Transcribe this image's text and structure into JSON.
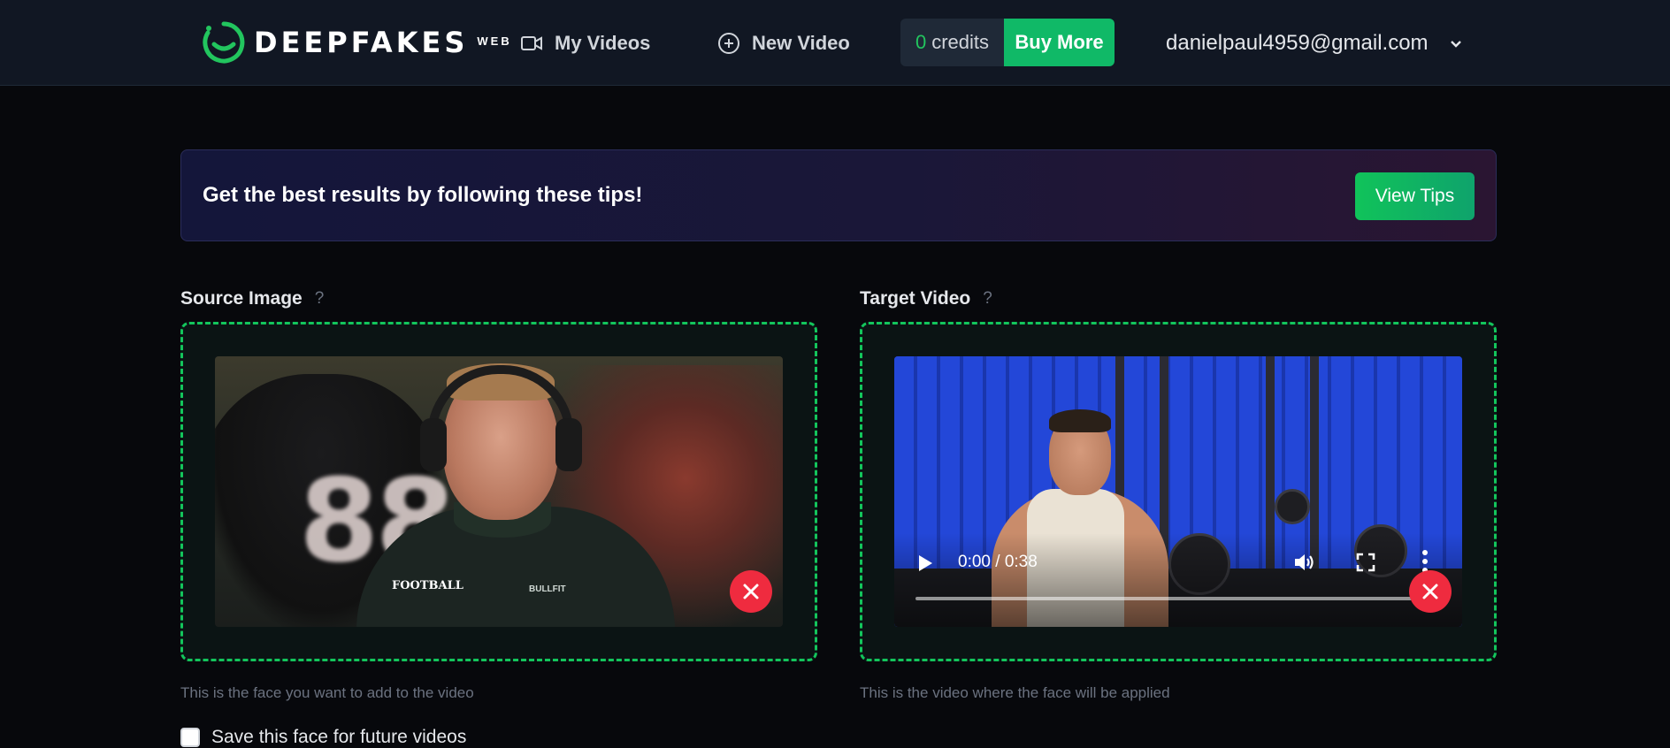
{
  "brand": {
    "name": "DEEPFAKES",
    "suffix": "WEB",
    "accent": "#22c55e"
  },
  "nav": {
    "my_videos": "My Videos",
    "new_video": "New Video"
  },
  "credits": {
    "count": "0",
    "label": "credits",
    "buy_label": "Buy More"
  },
  "account": {
    "email": "danielpaul4959@gmail.com"
  },
  "tips": {
    "text": "Get the best results by following these tips!",
    "button": "View Tips"
  },
  "source": {
    "label": "Source Image",
    "help": "?",
    "hint": "This is the face you want to add to the video",
    "photo_text": {
      "jersey": "88",
      "badge": "FOOTBALL",
      "brand": "BULLFIT"
    }
  },
  "target": {
    "label": "Target Video",
    "help": "?",
    "hint": "This is the video where the face will be applied",
    "player": {
      "time": "0:00 / 0:38"
    }
  },
  "save_face": {
    "label": "Save this face for future videos",
    "checked": false
  },
  "colors": {
    "danger": "#ef2b3f",
    "success": "#10b967",
    "dropzone_border": "#13c55c"
  }
}
